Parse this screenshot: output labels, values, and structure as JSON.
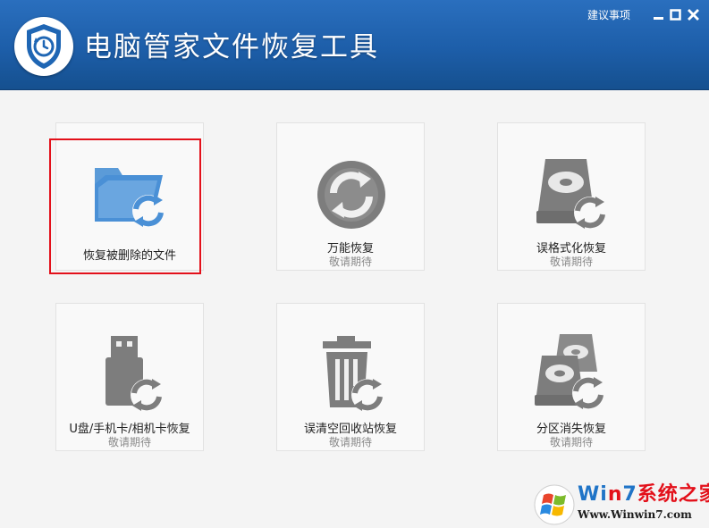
{
  "app": {
    "title": "电脑管家文件恢复工具",
    "suggest_label": "建议事项"
  },
  "window_controls": [
    "minimize",
    "maximize",
    "close"
  ],
  "tiles": [
    {
      "label": "恢复被删除的文件",
      "sub": "",
      "icon": "folder-restore-icon"
    },
    {
      "label": "万能恢复",
      "sub": "敬请期待",
      "icon": "universal-restore-icon"
    },
    {
      "label": "误格式化恢复",
      "sub": "敬请期待",
      "icon": "disk-restore-icon"
    },
    {
      "label": "U盘/手机卡/相机卡恢复",
      "sub": "敬请期待",
      "icon": "usb-restore-icon"
    },
    {
      "label": "误清空回收站恢复",
      "sub": "敬请期待",
      "icon": "recycle-bin-restore-icon"
    },
    {
      "label": "分区消失恢复",
      "sub": "敬请期待",
      "icon": "partition-restore-icon"
    }
  ],
  "watermark": {
    "line1_a": "Wi",
    "line1_b": "n",
    "line1_c": "7",
    "line1_d": "系统之家",
    "line2": "Www.Winwin7.com"
  },
  "colors": {
    "titlebar": "#1d5ea9",
    "highlight": "#e3101a",
    "icon_gray": "#7d7d7d",
    "icon_blue": "#4a90d6"
  }
}
